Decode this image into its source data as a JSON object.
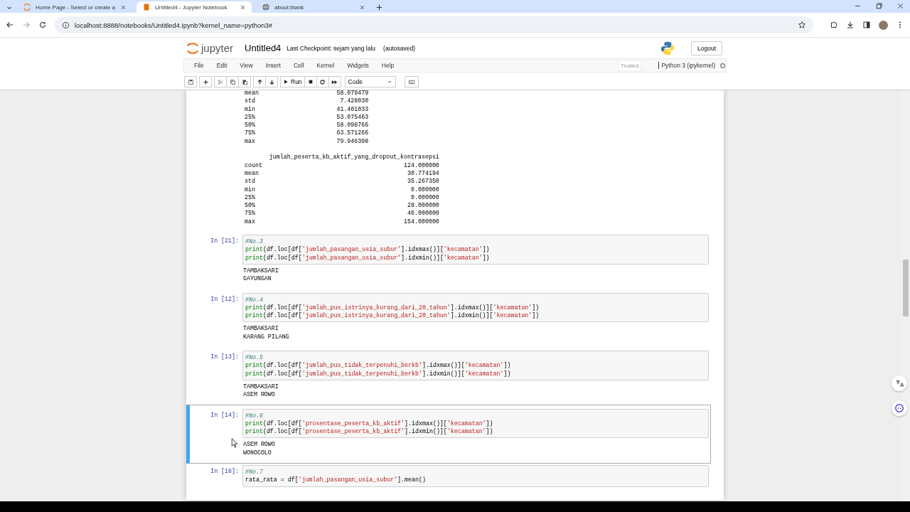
{
  "browser": {
    "tabs": [
      {
        "title": "Home Page - Select or create a",
        "selected": false
      },
      {
        "title": "Untitled4 - Jupyter Notebook",
        "selected": true
      },
      {
        "title": "about:blank",
        "selected": false
      }
    ],
    "url": "localhost:8888/notebooks/Untitled4.ipynb?kernel_name=python3#"
  },
  "header": {
    "logo_text": "jupyter",
    "notebook_name": "Untitled4",
    "checkpoint": "Last Checkpoint: sejam yang lalu",
    "autosave": "(autosaved)",
    "logout": "Logout"
  },
  "menu": [
    "File",
    "Edit",
    "View",
    "Insert",
    "Cell",
    "Kernel",
    "Widgets",
    "Help"
  ],
  "trusted": "Trusted",
  "kernel": "Python 3 (ipykernel)",
  "toolbar": {
    "run": "Run",
    "cell_type": "Code"
  },
  "describe_tables": [
    {
      "rows": [
        [
          "mean",
          "58.079479"
        ],
        [
          "std",
          "7.428030"
        ],
        [
          "min",
          "41.401033"
        ],
        [
          "25%",
          "53.075463"
        ],
        [
          "50%",
          "58.098766"
        ],
        [
          "75%",
          "63.571266"
        ],
        [
          "max",
          "79.946398"
        ]
      ]
    },
    {
      "header": "jumlah_peserta_kb_aktif_yang_dropout_kontrasepsi",
      "rows": [
        [
          "count",
          "124.000000"
        ],
        [
          "mean",
          "30.774194"
        ],
        [
          "std",
          "35.267350"
        ],
        [
          "min",
          "0.000000"
        ],
        [
          "25%",
          "0.000000"
        ],
        [
          "50%",
          "28.000000"
        ],
        [
          "75%",
          "46.000000"
        ],
        [
          "max",
          "154.000000"
        ]
      ]
    }
  ],
  "cells": [
    {
      "prompt": "In [21]:",
      "selected": false,
      "code": [
        "#No.3",
        "print(df.loc[df['jumlah_pasangan_usia_subur'].idxmax()]['kecamatan'])",
        "print(df.loc[df['jumlah_pasangan_usia_subur'].idxmin()]['kecamatan'])"
      ],
      "output": [
        "TAMBAKSARI",
        "GAYUNGAN"
      ]
    },
    {
      "prompt": "In [12]:",
      "selected": false,
      "code": [
        "#No.4",
        "print(df.loc[df['jumlah_pus_istrinya_kurang_dari_20_tahun'].idxmax()]['kecamatan'])",
        "print(df.loc[df['jumlah_pus_istrinya_kurang_dari_20_tahun'].idxmin()]['kecamatan'])"
      ],
      "output": [
        "TAMBAKSARI",
        "KARANG PILANG"
      ]
    },
    {
      "prompt": "In [13]:",
      "selected": false,
      "code": [
        "#No.5",
        "print(df.loc[df['jumlah_pus_tidak_terpenuhi_berkb'].idxmax()]['kecamatan'])",
        "print(df.loc[df['jumlah_pus_tidak_terpenuhi_berkb'].idxmin()]['kecamatan'])"
      ],
      "output": [
        "TAMBAKSARI",
        "ASEM ROWO"
      ]
    },
    {
      "prompt": "In [14]:",
      "selected": true,
      "code": [
        "#No.6",
        "print(df.loc[df['prosentase_peserta_kb_aktif'].idxmax()]['kecamatan'])",
        "print(df.loc[df['prosentase_peserta_kb_aktif'].idxmin()]['kecamatan'])"
      ],
      "output": [
        "ASEM ROWO",
        "WONOCOLO"
      ]
    },
    {
      "prompt": "In [16]:",
      "selected": false,
      "code": [
        "#No.7",
        "rata_rata = df['jumlah_pasangan_usia_subur'].mean()"
      ]
    }
  ]
}
